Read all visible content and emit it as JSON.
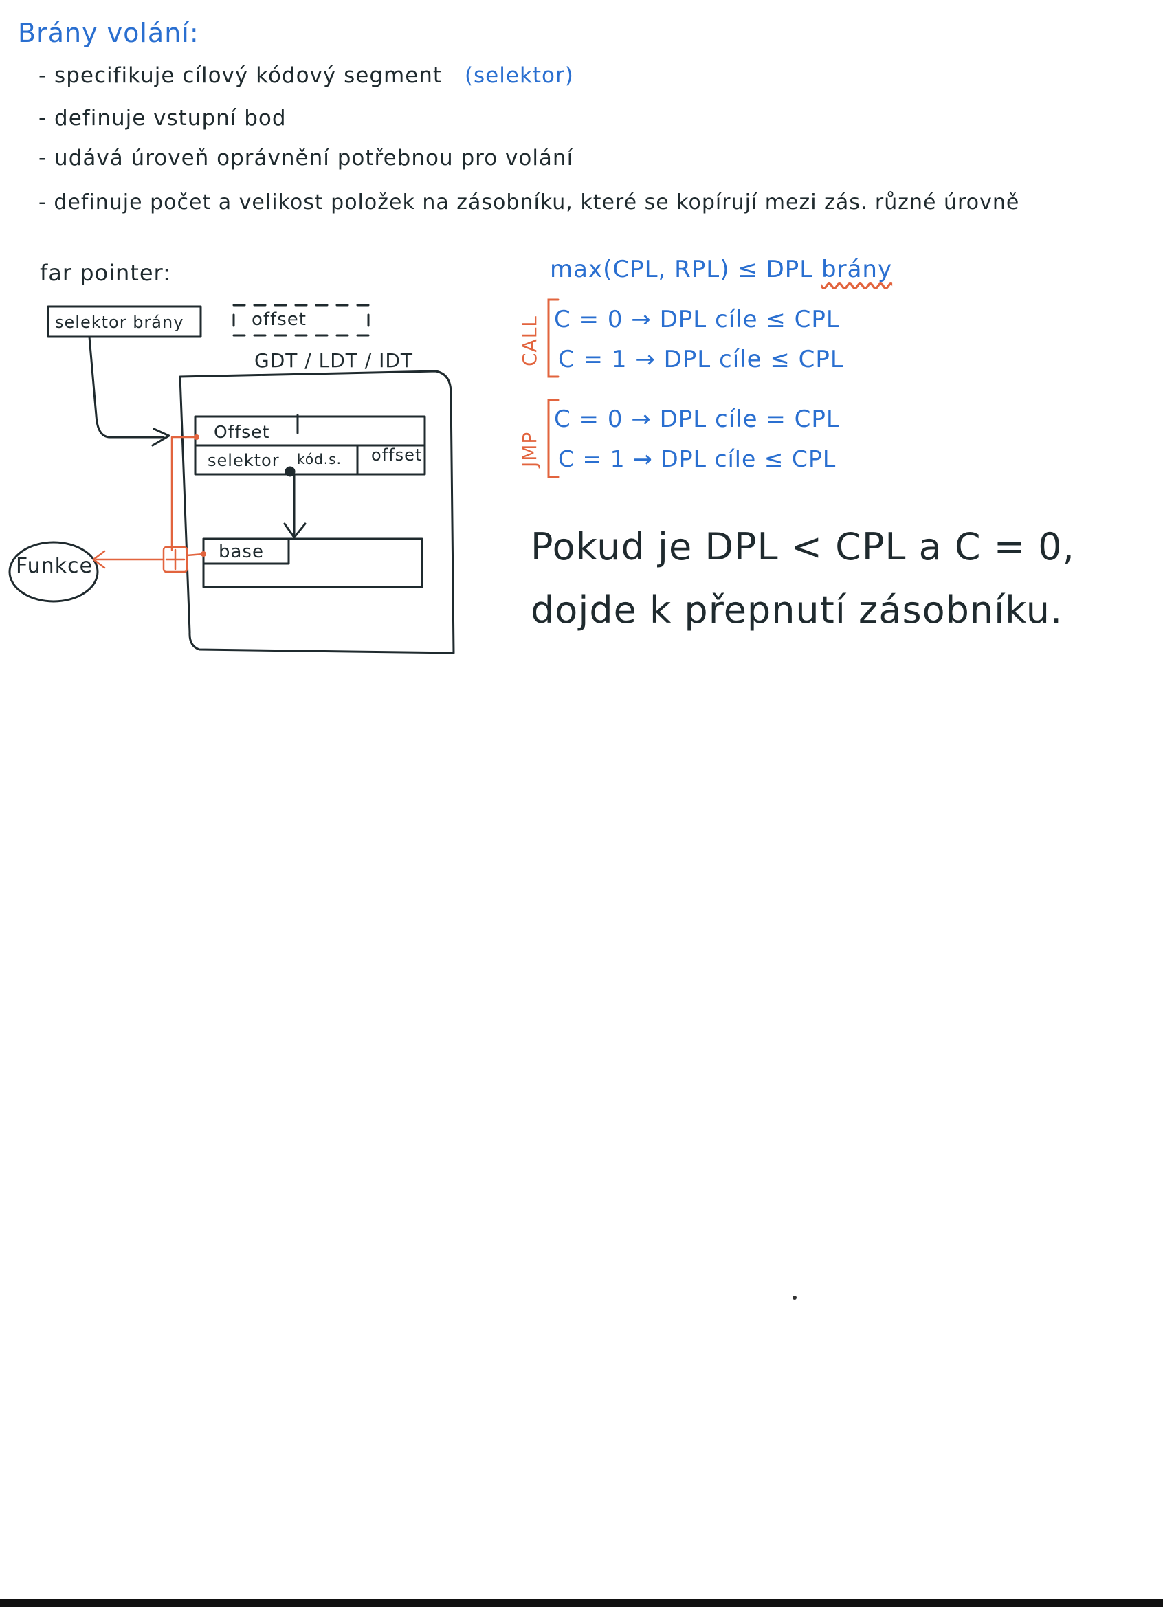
{
  "heading": "Brány volání:",
  "bullets": [
    "- specifikuje cílový kódový segment",
    "(selektor)",
    "- definuje vstupní bod",
    "- udává úroveň oprávnění potřebnou pro volání",
    "- definuje počet a velikost položek na zásobníku, které se kopírují mezi zás. různé úrovně"
  ],
  "diagram": {
    "far_pointer_label": "far pointer:",
    "selector_box": "selektor brány",
    "offset_box": "offset",
    "table_label": "GDT / LDT / IDT",
    "row1": "Offset",
    "row2_selector": "selektor",
    "row2_kod": "kód.s.",
    "row2_offset": "offset",
    "base": "base",
    "function": "Funkce"
  },
  "rules": {
    "max_line_main": "max(CPL, RPL) ≤ DPL",
    "max_line_word": "brány",
    "call_label": "CALL",
    "jmp_label": "JMP",
    "call": [
      "C = 0 → DPL cíle ≤ CPL",
      "C = 1 → DPL cíle ≤ CPL"
    ],
    "jmp": [
      "C = 0 → DPL cíle = CPL",
      "C = 1 → DPL cíle ≤ CPL"
    ]
  },
  "conclusion": [
    "Pokud je DPL < CPL a C = 0,",
    "dojde k přepnutí zásobníku."
  ],
  "colors": {
    "ink_blue": "#2a6fd0",
    "ink_dark": "#1f2a2e",
    "ink_orange": "#e2643e"
  }
}
